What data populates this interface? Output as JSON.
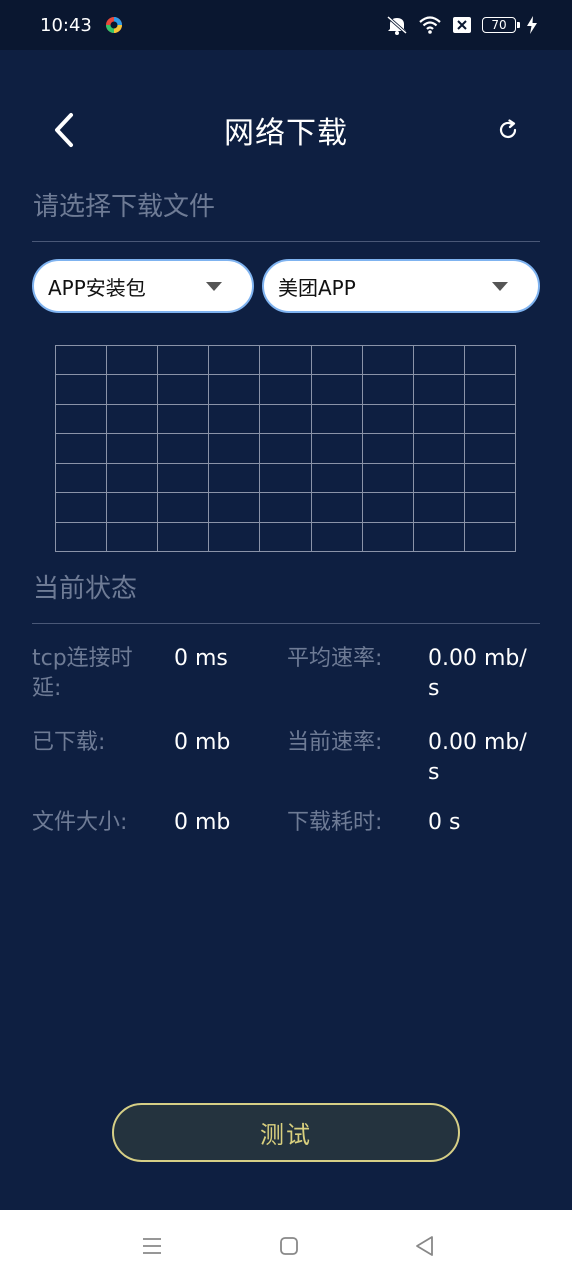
{
  "status_bar": {
    "time": "10:43",
    "battery": "70"
  },
  "header": {
    "title": "网络下载"
  },
  "select_section": {
    "heading": "请选择下载文件"
  },
  "dropdowns": {
    "category": "APP安装包",
    "file": "美团APP"
  },
  "status_section": {
    "heading": "当前状态",
    "stats": {
      "tcp_label_line1": "tcp连接时",
      "tcp_label_line2": "延:",
      "tcp_value": "0 ms",
      "avg_label": "平均速率:",
      "avg_value_line1": "0.00 mb/",
      "avg_value_line2": "s",
      "downloaded_label": "已下载:",
      "downloaded_value": "0 mb",
      "cur_label": "当前速率:",
      "cur_value_line1": "0.00 mb/",
      "cur_value_line2": "s",
      "size_label": "文件大小:",
      "size_value": "0 mb",
      "time_label": "下载耗时:",
      "time_value": "0 s"
    }
  },
  "test_button": {
    "label": "测试"
  },
  "colors": {
    "background": "#0e1f41",
    "accent": "#d9d07e",
    "muted_text": "#6e7b95",
    "dropdown_border": "#7fb3f0"
  }
}
